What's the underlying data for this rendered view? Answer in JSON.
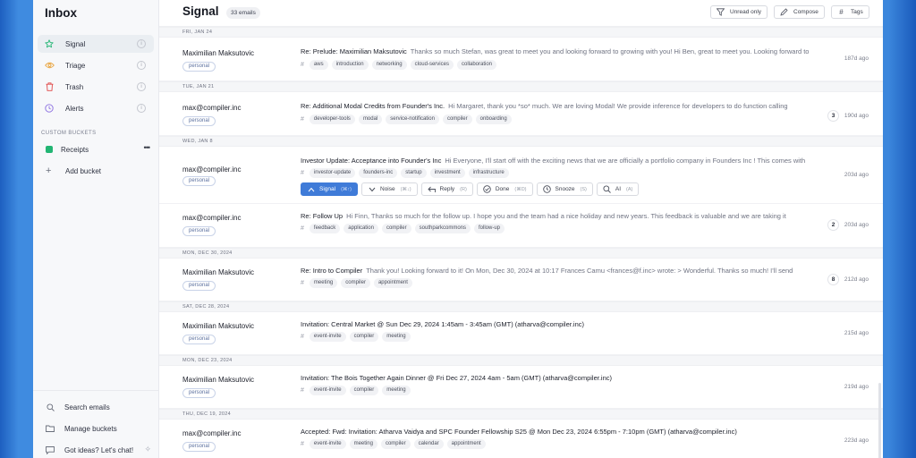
{
  "sidebar": {
    "title": "Inbox",
    "items": [
      {
        "label": "Signal",
        "info": "i"
      },
      {
        "label": "Triage",
        "info": "i"
      },
      {
        "label": "Trash",
        "info": "i"
      },
      {
        "label": "Alerts",
        "info": "i"
      }
    ],
    "section_label": "CUSTOM BUCKETS",
    "bucket": {
      "label": "Receipts",
      "more": "•••",
      "color": "#22b573"
    },
    "add_bucket": "Add bucket",
    "bottom": [
      {
        "label": "Search emails"
      },
      {
        "label": "Manage buckets"
      },
      {
        "label": "Got ideas? Let's chat!"
      }
    ]
  },
  "header": {
    "title": "Signal",
    "count": "33 emails",
    "buttons": {
      "unread": "Unread only",
      "compose": "Compose",
      "tags": "Tags"
    }
  },
  "groups": [
    {
      "date": "FRI, JAN 24",
      "emails": [
        {
          "sender": "Maximilian Maksutovic",
          "label": "personal",
          "subject": "Re: Prelude: Maximilian Maksutovic",
          "preview": "Thanks so much Stefan, was great to meet you and looking forward to growing with you! Hi Ben, great to meet you. Looking forward to",
          "tags": [
            "aws",
            "introduction",
            "networking",
            "cloud-services",
            "collaboration"
          ],
          "count": "",
          "ago": "187d ago"
        }
      ]
    },
    {
      "date": "TUE, JAN 21",
      "emails": [
        {
          "sender": "max@compiler.inc",
          "label": "personal",
          "subject": "Re: Additional Modal Credits from Founder's Inc.",
          "preview": "Hi Margaret, thank you *so* much. We are loving Modal! We provide inference for developers to do function calling",
          "tags": [
            "developer-tools",
            "modal",
            "service-notification",
            "compiler",
            "onboarding"
          ],
          "count": "3",
          "ago": "190d ago"
        }
      ]
    },
    {
      "date": "WED, JAN 8",
      "emails": [
        {
          "sender": "max@compiler.inc",
          "label": "personal",
          "subject": "Investor Update: Acceptance into Founder's Inc",
          "preview": "Hi Everyone, I'll start off with the exciting news that we are officially a portfolio company in Founders Inc ! This comes with",
          "tags": [
            "investor-update",
            "founders-inc",
            "startup",
            "investment",
            "infrastructure"
          ],
          "count": "",
          "ago": "203d ago",
          "expanded": true
        }
      ]
    },
    {
      "date": "",
      "emails": [
        {
          "sender": "max@compiler.inc",
          "label": "personal",
          "subject": "Re: Follow Up",
          "preview": "Hi Finn, Thanks so much for the follow up. I hope you and the team had a nice holiday and new years. This feedback is valuable and we are taking it",
          "tags": [
            "feedback",
            "application",
            "compiler",
            "southparkcommons",
            "follow-up"
          ],
          "count": "2",
          "ago": "203d ago"
        }
      ]
    },
    {
      "date": "MON, DEC 30, 2024",
      "emails": [
        {
          "sender": "Maximilian Maksutovic",
          "label": "personal",
          "subject": "Re: Intro to Compiler",
          "preview": "Thank you! Looking forward to it! On Mon, Dec 30, 2024 at 10:17 Frances Camu <frances@f.inc> wrote: > Wonderful. Thanks so much! I'll send",
          "tags": [
            "meeting",
            "compiler",
            "appointment"
          ],
          "count": "8",
          "ago": "212d ago"
        }
      ]
    },
    {
      "date": "SAT, DEC 28, 2024",
      "emails": [
        {
          "sender": "Maximilian Maksutovic",
          "label": "personal",
          "subject": "Invitation: Central Market @ Sun Dec 29, 2024 1:45am - 3:45am (GMT) (atharva@compiler.inc)",
          "preview": "",
          "tags": [
            "event-invite",
            "compiler",
            "meeting"
          ],
          "count": "",
          "ago": "215d ago"
        }
      ]
    },
    {
      "date": "MON, DEC 23, 2024",
      "emails": [
        {
          "sender": "Maximilian Maksutovic",
          "label": "personal",
          "subject": "Invitation: The Bois Together Again Dinner @ Fri Dec 27, 2024 4am - 5am (GMT) (atharva@compiler.inc)",
          "preview": "",
          "tags": [
            "event-invite",
            "compiler",
            "meeting"
          ],
          "count": "",
          "ago": "219d ago"
        }
      ]
    },
    {
      "date": "THU, DEC 19, 2024",
      "emails": [
        {
          "sender": "max@compiler.inc",
          "label": "personal",
          "subject": "Accepted: Fwd: Invitation: Atharva Vaidya and SPC Founder Fellowship S25 @ Mon Dec 23, 2024 6:55pm - 7:10pm (GMT) (atharva@compiler.inc)",
          "preview": "",
          "tags": [
            "event-invite",
            "meeting",
            "compiler",
            "calendar",
            "appointment"
          ],
          "count": "",
          "ago": "223d ago"
        }
      ]
    }
  ],
  "actions": [
    {
      "label": "Signal",
      "kbd": "(⌘↑)"
    },
    {
      "label": "Noise",
      "kbd": "(⌘↓)"
    },
    {
      "label": "Reply",
      "kbd": "(R)"
    },
    {
      "label": "Done",
      "kbd": "(⌘D)"
    },
    {
      "label": "Snooze",
      "kbd": "(S)"
    },
    {
      "label": "AI",
      "kbd": "(A)"
    }
  ],
  "icons": [
    "star-icon",
    "eye-icon",
    "trash-icon",
    "clock-icon",
    "plus-icon",
    "search-icon",
    "folder-icon",
    "chat-icon",
    "sparkle-icon",
    "filter-icon",
    "pencil-icon",
    "hash-icon",
    "chevron-up-icon",
    "chevron-down-icon",
    "reply-icon",
    "check-circle-icon",
    "clock-icon",
    "search-icon"
  ],
  "colors": {
    "accent": "#3f7bd8",
    "signal": "#22b573",
    "triage": "#e8a23a",
    "trash": "#e04848",
    "alerts": "#8a6ee0"
  }
}
